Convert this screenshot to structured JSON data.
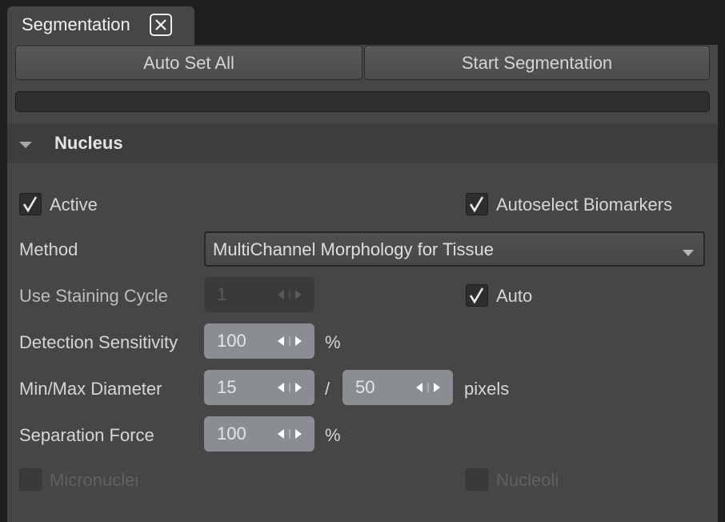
{
  "tab": {
    "title": "Segmentation"
  },
  "toolbar": {
    "auto_set_all_label": "Auto Set All",
    "start_segmentation_label": "Start Segmentation"
  },
  "progress": {
    "value": 0
  },
  "section": {
    "title": "Nucleus",
    "active": {
      "label": "Active",
      "checked": true
    },
    "autoselect": {
      "label": "Autoselect Biomarkers",
      "checked": true
    },
    "method": {
      "label": "Method",
      "value": "MultiChannel Morphology for Tissue"
    },
    "staining_cycle": {
      "label": "Use Staining Cycle",
      "value": "1",
      "enabled": false
    },
    "auto": {
      "label": "Auto",
      "checked": true
    },
    "detection_sensitivity": {
      "label": "Detection Sensitivity",
      "value": "100",
      "unit": "%"
    },
    "diameter": {
      "label": "Min/Max Diameter",
      "min": "15",
      "separator": "/",
      "max": "50",
      "unit": "pixels"
    },
    "separation_force": {
      "label": "Separation Force",
      "value": "100",
      "unit": "%"
    },
    "micronuclei": {
      "label": "Micronuclei",
      "checked": false,
      "enabled": false
    },
    "nucleoli": {
      "label": "Nucleoli",
      "checked": false,
      "enabled": false
    }
  },
  "colors": {
    "panel": "#464646",
    "background": "#1e1e1e",
    "spin_field": "#8a8e93"
  }
}
